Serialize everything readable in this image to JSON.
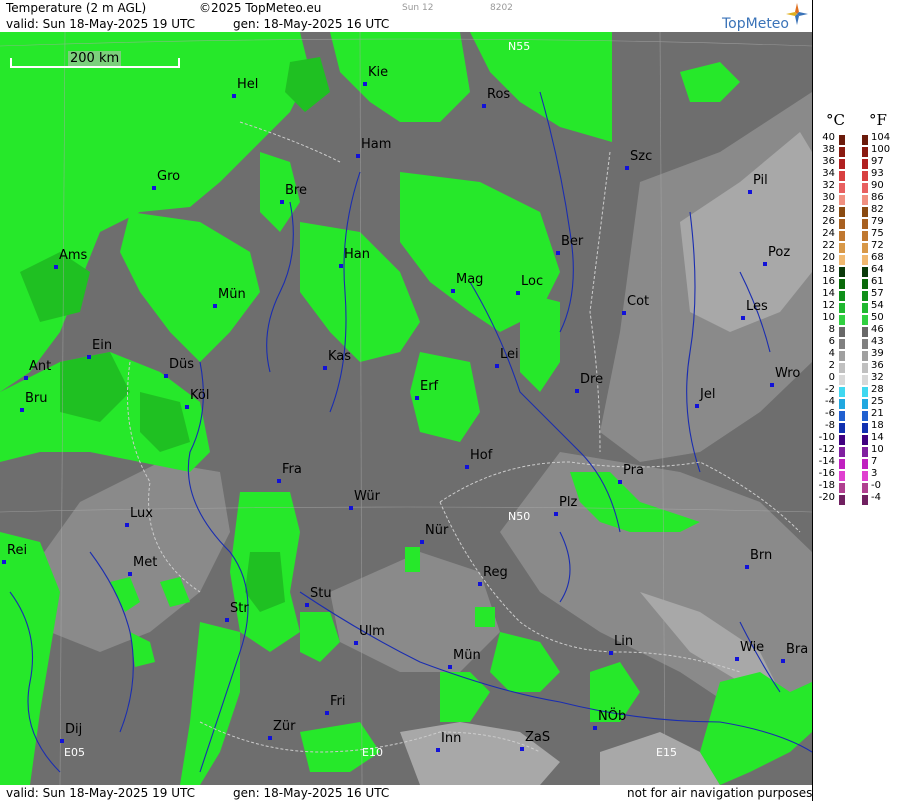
{
  "header": {
    "title": "Temperature (2 m AGL)",
    "copyright": "©2025 TopMeteo.eu",
    "tag1": "Sun 12",
    "tag2": "8202",
    "valid": "valid:  Sun  18-May-2025  19 UTC",
    "gen": "gen: 18-May-2025 16 UTC",
    "logo": "TopMeteo"
  },
  "footer": {
    "valid": "valid:  Sun  18-May-2025  19 UTC",
    "gen": "gen: 18-May-2025 16 UTC",
    "notice": "not for air navigation purposes"
  },
  "map": {
    "scale_label": "200 km",
    "grid_labels": [
      "N55",
      "N50",
      "E05",
      "E10",
      "E15"
    ],
    "cities": [
      "Kie",
      "Hel",
      "Ros",
      "Ham",
      "Szc",
      "Gro",
      "Bre",
      "Pil",
      "Ber",
      "Ams",
      "Han",
      "Poz",
      "Mag",
      "Loc",
      "Mün",
      "Cot",
      "Les",
      "Ein",
      "Kas",
      "Lei",
      "Ant",
      "Düs",
      "Wro",
      "Erf",
      "Dre",
      "Bru",
      "Köl",
      "Jel",
      "Hof",
      "Fra",
      "Pra",
      "Würz",
      "Plz",
      "Lux",
      "Nür",
      "Rei",
      "Met",
      "Brn",
      "Reg",
      "Stu",
      "Str",
      "Ulm",
      "Lin",
      "München",
      "Wie",
      "Bra",
      "Fri",
      "Dij",
      "Zür",
      "NÖb",
      "Inn",
      "ZaS"
    ],
    "city_text": {
      "Kie": "Kie",
      "Hel": "Hel",
      "Ros": "Ros",
      "Ham": "Ham",
      "Szc": "Szc",
      "Gro": "Gro",
      "Bre": "Bre",
      "Pil": "Pil",
      "Ber": "Ber",
      "Ams": "Ams",
      "Han": "Han",
      "Poz": "Poz",
      "Mag": "Mag",
      "Loc": "Loc",
      "Mün": "Mün",
      "Cot": "Cot",
      "Les": "Les",
      "Ein": "Ein",
      "Kas": "Kas",
      "Lei": "Lei",
      "Ant": "Ant",
      "Düs": "Düs",
      "Wro": "Wro",
      "Erf": "Erf",
      "Dre": "Dre",
      "Bru": "Bru",
      "Köl": "Köl",
      "Jel": "Jel",
      "Hof": "Hof",
      "Fra": "Fra",
      "Pra": "Pra",
      "Würz": "Wür",
      "Plz": "Plz",
      "Lux": "Lux",
      "Nür": "Nür",
      "Rei": "Rei",
      "Met": "Met",
      "Brn": "Brn",
      "Reg": "Reg",
      "Stu": "Stu",
      "Str": "Str",
      "Ulm": "Ulm",
      "Lin": "Lin",
      "München": "Mün",
      "Wie": "Wie",
      "Bra": "Bra",
      "Fri": "Fri",
      "Dij": "Dij",
      "Zür": "Zür",
      "NÖb": "NÖb",
      "Inn": "Inn",
      "ZaS": "ZaS"
    }
  },
  "legend": {
    "celsius_unit": "°C",
    "fahrenheit_unit": "°F",
    "celsius": [
      "40",
      "38",
      "36",
      "34",
      "32",
      "30",
      "28",
      "26",
      "24",
      "22",
      "20",
      "18",
      "16",
      "14",
      "12",
      "10",
      "8",
      "6",
      "4",
      "2",
      "0",
      "-2",
      "-4",
      "-6",
      "-8",
      "-10",
      "-12",
      "-14",
      "-16",
      "-18",
      "-20"
    ],
    "fahrenheit": [
      "104",
      "100",
      "97",
      "93",
      "90",
      "86",
      "82",
      "79",
      "75",
      "72",
      "68",
      "64",
      "61",
      "57",
      "54",
      "50",
      "46",
      "43",
      "39",
      "36",
      "32",
      "28",
      "25",
      "21",
      "18",
      "14",
      "10",
      "7",
      "3",
      "-0",
      "-4"
    ],
    "colors": [
      "#6b1a0a",
      "#8a1a10",
      "#b02020",
      "#d84040",
      "#e86060",
      "#f09080",
      "#8a4a10",
      "#a86020",
      "#c07830",
      "#d89848",
      "#f0b870",
      "#0a3a0a",
      "#0a6a0a",
      "#10901a",
      "#20b830",
      "#30d040",
      "#686868",
      "#808080",
      "#a0a0a0",
      "#c0c0c0",
      "#d8d8d8",
      "#40d8f0",
      "#20a8e0",
      "#2060d0",
      "#1030b0",
      "#400080",
      "#8020a0",
      "#c020c0",
      "#e040d0",
      "#b04090",
      "#702060"
    ]
  }
}
